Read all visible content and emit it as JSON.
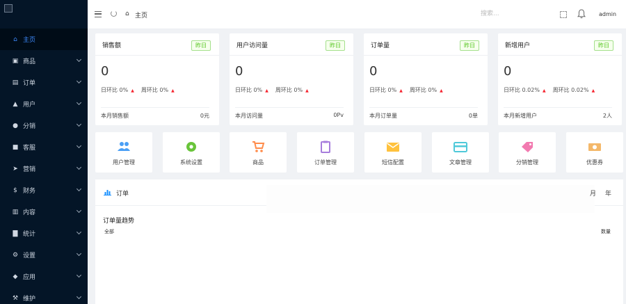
{
  "sidebar": {
    "items": [
      {
        "label": "主页",
        "icon": "home-icon",
        "glyph": "⌂",
        "active": true
      },
      {
        "label": "商品",
        "icon": "bag-icon",
        "glyph": "▣"
      },
      {
        "label": "订单",
        "icon": "cart-icon",
        "glyph": "▤"
      },
      {
        "label": "用户",
        "icon": "user-icon",
        "glyph": "▲"
      },
      {
        "label": "分销",
        "icon": "share-icon",
        "glyph": "●"
      },
      {
        "label": "客服",
        "icon": "chat-icon",
        "glyph": "■"
      },
      {
        "label": "营销",
        "icon": "send-icon",
        "glyph": "➤"
      },
      {
        "label": "财务",
        "icon": "dollar-icon",
        "glyph": "$"
      },
      {
        "label": "内容",
        "icon": "book-icon",
        "glyph": "▥"
      },
      {
        "label": "统计",
        "icon": "bar-chart-icon",
        "glyph": "▇"
      },
      {
        "label": "设置",
        "icon": "gear-icon",
        "glyph": "⚙"
      },
      {
        "label": "应用",
        "icon": "cube-icon",
        "glyph": "◆"
      },
      {
        "label": "维护",
        "icon": "wrench-icon",
        "glyph": "⚒"
      }
    ]
  },
  "header": {
    "breadcrumb": "主页",
    "search_placeholder": "搜索...",
    "user": "admin"
  },
  "stats": [
    {
      "title": "销售额",
      "badge": "昨日",
      "value": "0",
      "day_label": "日环比",
      "day_value": "0%",
      "week_label": "周环比",
      "week_value": "0%",
      "foot_label": "本月销售额",
      "foot_value": "0元"
    },
    {
      "title": "用户访问量",
      "badge": "昨日",
      "value": "0",
      "day_label": "日环比",
      "day_value": "0%",
      "week_label": "周环比",
      "week_value": "0%",
      "foot_label": "本月访问量",
      "foot_value": "0Pv"
    },
    {
      "title": "订单量",
      "badge": "昨日",
      "value": "0",
      "day_label": "日环比",
      "day_value": "0%",
      "week_label": "周环比",
      "week_value": "0%",
      "foot_label": "本月订单量",
      "foot_value": "0单"
    },
    {
      "title": "新增用户",
      "badge": "昨日",
      "value": "0",
      "day_label": "日环比",
      "day_value": "0.02%",
      "week_label": "周环比",
      "week_value": "0.02%",
      "foot_label": "本月新增用户",
      "foot_value": "2人"
    }
  ],
  "tiles": [
    {
      "label": "用户管理",
      "icon": "users-icon",
      "color": "#4a9ff5"
    },
    {
      "label": "系统设置",
      "icon": "settings-icon",
      "color": "#69c43a"
    },
    {
      "label": "商品",
      "icon": "cart-icon",
      "color": "#ff8c4b"
    },
    {
      "label": "订单管理",
      "icon": "clipboard-icon",
      "color": "#a77ddc"
    },
    {
      "label": "短信配置",
      "icon": "mail-icon",
      "color": "#ffc23d"
    },
    {
      "label": "文章管理",
      "icon": "card-icon",
      "color": "#4fc9d9"
    },
    {
      "label": "分销管理",
      "icon": "tag-icon",
      "color": "#f27ab0"
    },
    {
      "label": "优惠券",
      "icon": "money-icon",
      "color": "#f4b86a"
    }
  ],
  "order_panel": {
    "title": "订单",
    "tab_fragment": "月",
    "tab_year": "年",
    "chart_title": "订单量趋势",
    "legend_all": "全部",
    "y_label": "数量"
  },
  "colors": {
    "sidebar_bg": "#041527",
    "accent": "#3d8bff",
    "badge_green": "#52c41a",
    "arrow_red": "#f5222d"
  }
}
